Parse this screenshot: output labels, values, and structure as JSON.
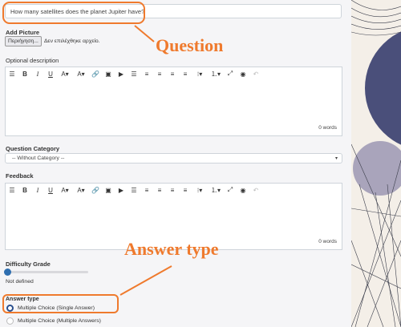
{
  "question_input": {
    "value": "How many satellites does the planet Jupiter have?"
  },
  "add_picture": {
    "label": "Add Picture",
    "browse_button": "Περιήγηση...",
    "no_file_text": "Δεν επιλέχθηκε αρχείο."
  },
  "optional_description": {
    "label": "Optional description",
    "words": "0 words"
  },
  "question_category": {
    "label": "Question Category",
    "selected": "-- Without Category --"
  },
  "feedback": {
    "label": "Feedback",
    "words": "0 words"
  },
  "difficulty": {
    "label": "Difficulty Grade",
    "value_text": "Not defined",
    "level": 0
  },
  "answer_type": {
    "label": "Answer type",
    "options": [
      "Multiple Choice (Single Answer)",
      "Multiple Choice (Multiple Answers)"
    ],
    "selected_index": 0
  },
  "annotations": {
    "question": "Question",
    "answer_type": "Answer type"
  },
  "colors": {
    "accent": "#ef7a2d",
    "slider": "#2f6fb0",
    "radio_selected": "#2a4f8e"
  },
  "toolbar_icons": [
    "list-icon",
    "bold-icon",
    "italic-icon",
    "underline-icon",
    "font-color-icon",
    "highlight-color-icon",
    "link-icon",
    "image-icon",
    "media-icon",
    "horizontal-rule-icon",
    "align-left-icon",
    "align-center-icon",
    "align-right-icon",
    "align-justify-icon",
    "bullet-list-icon",
    "numbered-list-icon",
    "fullscreen-icon",
    "preview-icon",
    "undo-icon"
  ]
}
